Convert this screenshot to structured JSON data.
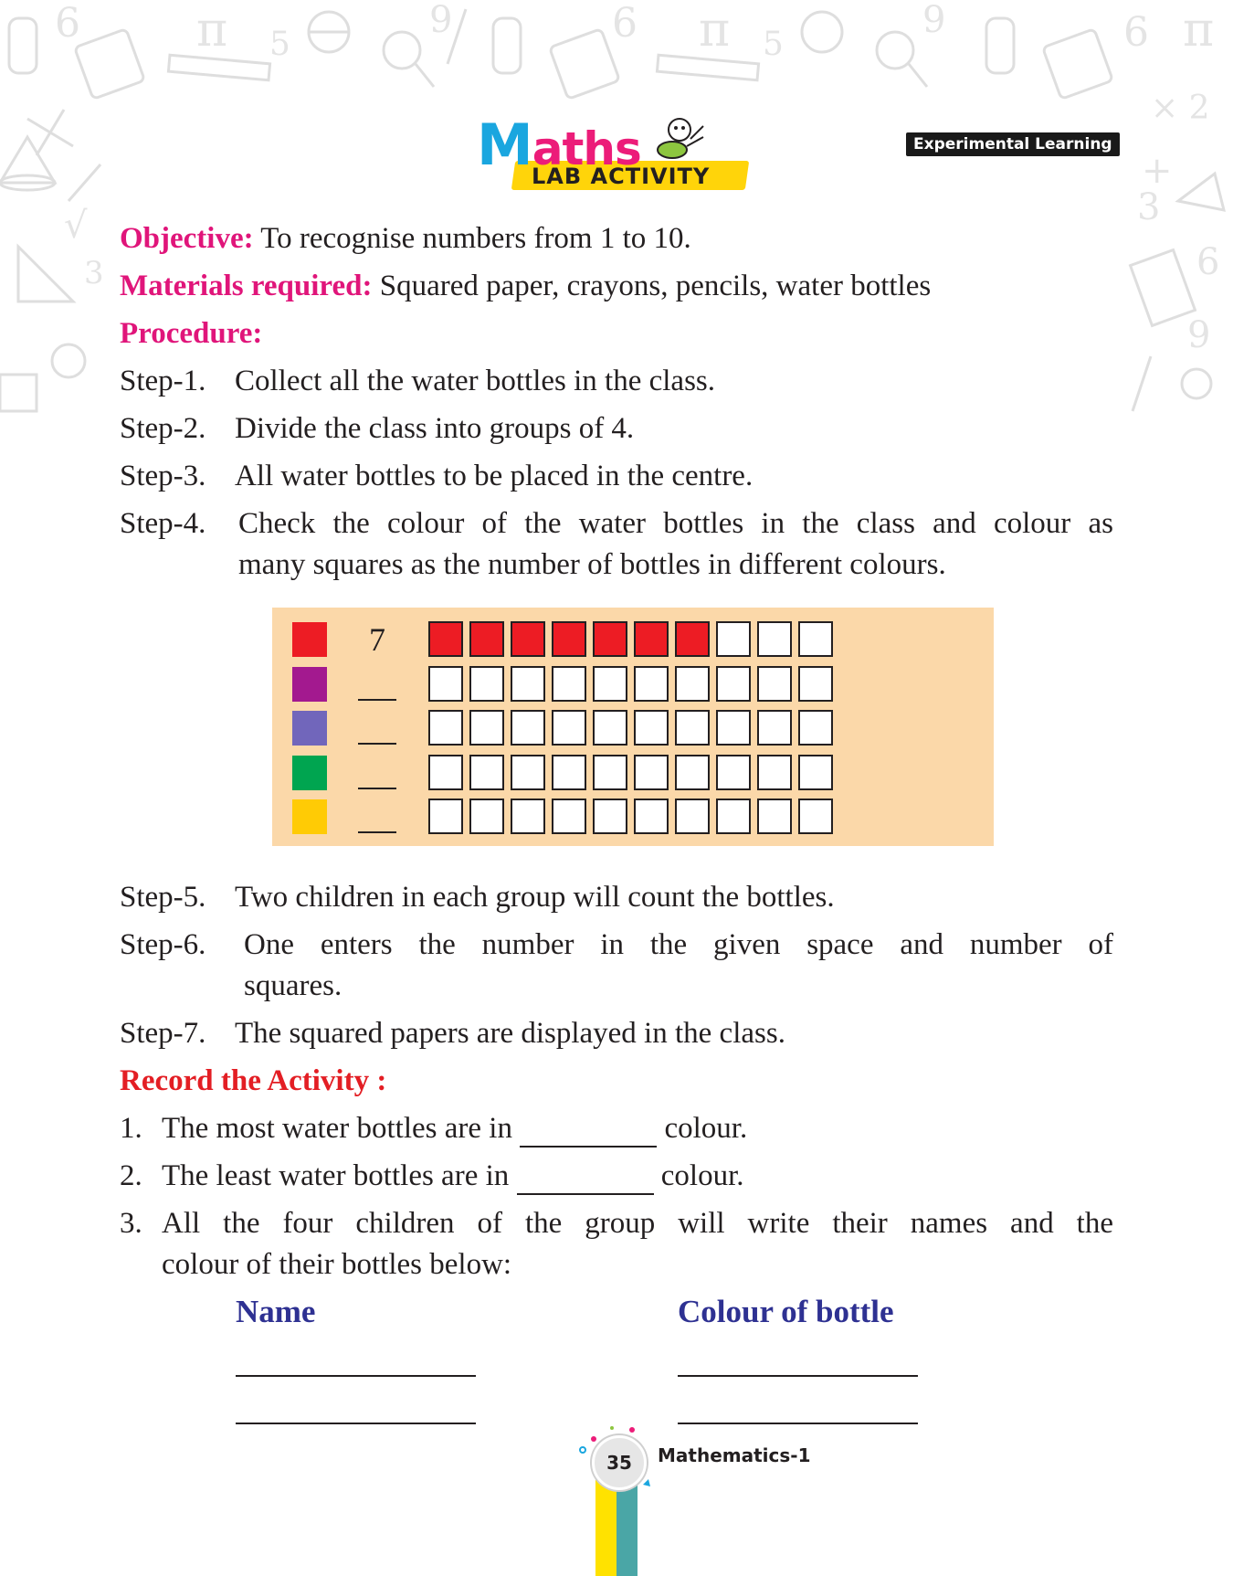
{
  "header": {
    "logo_maths": "Maths",
    "logo_lab": "LAB ACTIVITY",
    "badge": "Experimental Learning"
  },
  "objective": {
    "label": "Objective:",
    "text": "To recognise numbers from 1 to 10."
  },
  "materials": {
    "label": "Materials required:",
    "text": "Squared paper, crayons, pencils, water bottles"
  },
  "procedure": {
    "label": "Procedure:",
    "steps": [
      {
        "num": "Step-1.",
        "text": "Collect all the water bottles in the class."
      },
      {
        "num": "Step-2.",
        "text": "Divide the class into groups of 4."
      },
      {
        "num": "Step-3.",
        "text": "All water bottles to be placed in the centre."
      },
      {
        "num": "Step-4.",
        "text1": "Check the colour of the water bottles in the class and colour as",
        "text2": "many squares as the number of bottles in different colours."
      },
      {
        "num": "Step-5.",
        "text": "Two children in each group will count the bottles."
      },
      {
        "num": "Step-6.",
        "text1": "One enters the number in the given space and number of",
        "text2": "squares."
      },
      {
        "num": "Step-7.",
        "text": "The squared papers are displayed in the class."
      }
    ]
  },
  "chart_data": {
    "type": "table",
    "rows": [
      {
        "color": "#ed1c24",
        "count": "7",
        "filled": 7
      },
      {
        "color": "#a3198f",
        "count": "",
        "filled": 0
      },
      {
        "color": "#7166bb",
        "count": "",
        "filled": 0
      },
      {
        "color": "#00a550",
        "count": "",
        "filled": 0
      },
      {
        "color": "#ffcb05",
        "count": "",
        "filled": 0
      }
    ],
    "cells_per_row": 10
  },
  "record": {
    "label": "Record the Activity :",
    "q1": {
      "num": "1.",
      "before": "The most water bottles are in",
      "after": "colour."
    },
    "q2": {
      "num": "2.",
      "before": "The least water bottles are in",
      "after": "colour."
    },
    "q3": {
      "num": "3.",
      "line1": "All the four children of the group will write their names and the",
      "line2": "colour of their bottles below:"
    },
    "col_name": "Name",
    "col_colour": "Colour of bottle"
  },
  "footer": {
    "page": "35",
    "title": "Mathematics-1"
  }
}
